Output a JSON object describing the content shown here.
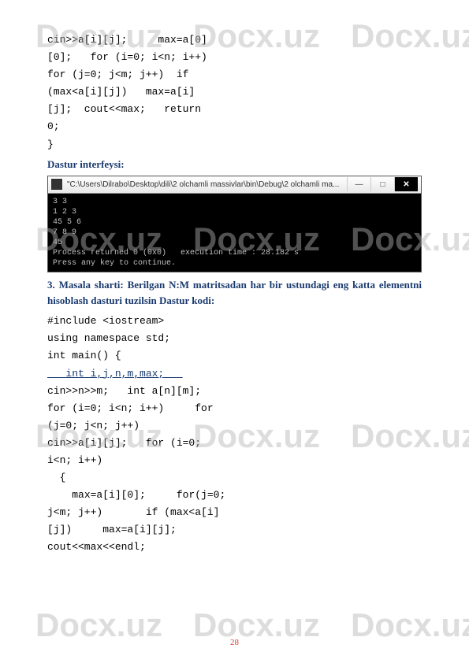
{
  "watermark": "Docx.uz",
  "code_top": "cin>>a[i][j];     max=a[0]\n[0];   for (i=0; i<n; i++)\nfor (j=0; j<m; j++)  if\n(max<a[i][j])   max=a[i]\n[j];  cout<<max;   return\n0;\n}",
  "interface_label": "Dastur interfeysi:",
  "terminal": {
    "title": "\"C:\\Users\\Dilrabo\\Desktop\\dili\\2 olchamli massivlar\\bin\\Debug\\2 olchamli ma...",
    "body": "3 3\n1 2 3\n45 5 6\n7 8 9\n45\nProcess returned 0 (0x0)   execution time : 28.182 s\nPress any key to continue."
  },
  "section3": "3.  Masala  sharti:  Berilgan  N:M  matritsadan  har  bir  ustundagi  eng  katta elementni hisoblash dasturi tuzilsin Dastur kodi:",
  "code_bottom_pre": "#include <iostream>\nusing namespace std;\nint main() {",
  "underlined_line": "   int i,j,n,m,max;   ",
  "code_bottom_post": "cin>>n>>m;   int a[n][m];\nfor (i=0; i<n; i++)     for\n(j=0; j<n; j++)\ncin>>a[i][j];   for (i=0;\ni<n; i++)\n  {\n    max=a[i][0];     for(j=0;\nj<m; j++)       if (max<a[i]\n[j])     max=a[i][j];\ncout<<max<<endl;",
  "page_number": "28"
}
